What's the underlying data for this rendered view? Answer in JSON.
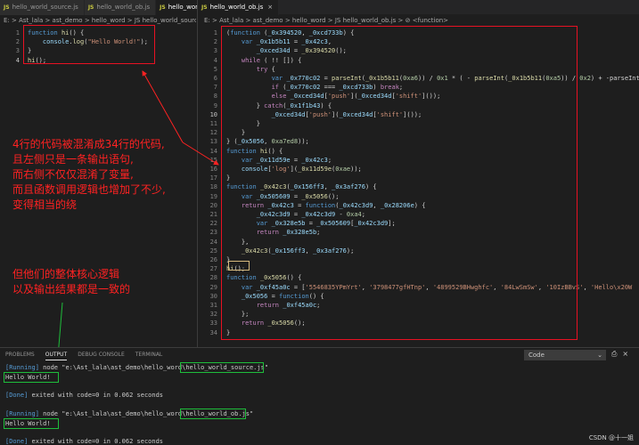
{
  "left_tabs": [
    {
      "label": "hello_world_source.js",
      "active": false
    },
    {
      "label": "hello_world_ob.js",
      "active": false
    },
    {
      "label": "hello_world_source.js",
      "active": true
    }
  ],
  "right_tabs": [
    {
      "label": "hello_world_ob.js",
      "active": true
    }
  ],
  "left_breadcrumb": "E: > Ast_lala > ast_demo > hello_word > JS hello_world_source.js > ...",
  "right_breadcrumb": "E: > Ast_lala > ast_demo > hello_word > JS hello_world_ob.js > ⊘ <function>",
  "left_code": [
    {
      "n": "1",
      "t": [
        [
          "kw",
          "function "
        ],
        [
          "fn",
          "hi"
        ],
        [
          "pn",
          "() {"
        ]
      ]
    },
    {
      "n": "2",
      "t": [
        [
          "pn",
          "    "
        ],
        [
          "vr",
          "console"
        ],
        [
          "pn",
          "."
        ],
        [
          "fn",
          "log"
        ],
        [
          "pn",
          "("
        ],
        [
          "str",
          "\"Hello World!\""
        ],
        [
          "pn",
          ");"
        ]
      ]
    },
    {
      "n": "3",
      "t": [
        [
          "pn",
          "}"
        ]
      ]
    },
    {
      "n": "4",
      "t": [
        [
          "fn",
          "hi"
        ],
        [
          "pn",
          "();"
        ]
      ]
    }
  ],
  "right_code": [
    {
      "n": "1",
      "t": [
        [
          "pn",
          "("
        ],
        [
          "kw",
          "function"
        ],
        [
          "pn",
          " ("
        ],
        [
          "vr",
          "_0x394520"
        ],
        [
          "pn",
          ", "
        ],
        [
          "vr",
          "_0xcd733b"
        ],
        [
          "pn",
          ") {"
        ]
      ]
    },
    {
      "n": "2",
      "t": [
        [
          "pn",
          "    "
        ],
        [
          "kw",
          "var "
        ],
        [
          "vr",
          "_0x1b5b11"
        ],
        [
          "pn",
          " = "
        ],
        [
          "vr",
          "_0x42c3"
        ],
        [
          "pn",
          ","
        ]
      ]
    },
    {
      "n": "3",
      "t": [
        [
          "pn",
          "        "
        ],
        [
          "vr",
          "_0xced34d"
        ],
        [
          "pn",
          " = "
        ],
        [
          "fn",
          "_0x394520"
        ],
        [
          "pn",
          "();"
        ]
      ]
    },
    {
      "n": "4",
      "t": [
        [
          "pn",
          "    "
        ],
        [
          "ctl",
          "while"
        ],
        [
          "pn",
          " ( !! []) {"
        ]
      ]
    },
    {
      "n": "5",
      "t": [
        [
          "pn",
          "        "
        ],
        [
          "ctl",
          "try"
        ],
        [
          "pn",
          " {"
        ]
      ]
    },
    {
      "n": "6",
      "t": [
        [
          "pn",
          "            "
        ],
        [
          "kw",
          "var "
        ],
        [
          "vr",
          "_0x770c02"
        ],
        [
          "pn",
          " = "
        ],
        [
          "fn",
          "parseInt"
        ],
        [
          "pn",
          "("
        ],
        [
          "fn",
          "_0x1b5b11"
        ],
        [
          "pn",
          "("
        ],
        [
          "num",
          "0xa6"
        ],
        [
          "pn",
          ")) / "
        ],
        [
          "num",
          "0x1"
        ],
        [
          "pn",
          " * ( - "
        ],
        [
          "fn",
          "parseInt"
        ],
        [
          "pn",
          "("
        ],
        [
          "fn",
          "_0x1b5b11"
        ],
        [
          "pn",
          "("
        ],
        [
          "num",
          "0xa5"
        ],
        [
          "pn",
          ")) / "
        ],
        [
          "num",
          "0x2"
        ],
        [
          "pn",
          ") + -parseInt"
        ]
      ]
    },
    {
      "n": "7",
      "t": [
        [
          "pn",
          "            "
        ],
        [
          "ctl",
          "if"
        ],
        [
          "pn",
          " ("
        ],
        [
          "vr",
          "_0x770c02"
        ],
        [
          "pn",
          " === "
        ],
        [
          "vr",
          "_0xcd733b"
        ],
        [
          "pn",
          ") "
        ],
        [
          "ctl",
          "break"
        ],
        [
          "pn",
          ";"
        ]
      ]
    },
    {
      "n": "8",
      "t": [
        [
          "pn",
          "            "
        ],
        [
          "ctl",
          "else "
        ],
        [
          "vr",
          "_0xced34d"
        ],
        [
          "pn",
          "["
        ],
        [
          "str",
          "'push'"
        ],
        [
          "pn",
          "]("
        ],
        [
          "vr",
          "_0xced34d"
        ],
        [
          "pn",
          "["
        ],
        [
          "str",
          "'shift'"
        ],
        [
          "pn",
          "]());"
        ]
      ]
    },
    {
      "n": "9",
      "t": [
        [
          "pn",
          "        } "
        ],
        [
          "ctl",
          "catch"
        ],
        [
          "pn",
          "("
        ],
        [
          "vr",
          "_0x1f1b43"
        ],
        [
          "pn",
          ") {"
        ]
      ]
    },
    {
      "n": "10",
      "t": [
        [
          "pn",
          "            "
        ],
        [
          "vr",
          "_0xced34d"
        ],
        [
          "pn",
          "["
        ],
        [
          "str",
          "'push'"
        ],
        [
          "pn",
          "]("
        ],
        [
          "vr",
          "_0xced34d"
        ],
        [
          "pn",
          "["
        ],
        [
          "str",
          "'shift'"
        ],
        [
          "pn",
          "]());"
        ]
      ]
    },
    {
      "n": "11",
      "t": [
        [
          "pn",
          "        }"
        ]
      ]
    },
    {
      "n": "12",
      "t": [
        [
          "pn",
          "    }"
        ]
      ]
    },
    {
      "n": "13",
      "t": [
        [
          "pn",
          "} ("
        ],
        [
          "vr",
          "_0x5056"
        ],
        [
          "pn",
          ", "
        ],
        [
          "num",
          "0xa7ed8"
        ],
        [
          "pn",
          "));"
        ]
      ]
    },
    {
      "n": "14",
      "t": [
        [
          "kw",
          "function "
        ],
        [
          "fn",
          "hi"
        ],
        [
          "pn",
          "() {"
        ]
      ]
    },
    {
      "n": "15",
      "t": [
        [
          "pn",
          "    "
        ],
        [
          "kw",
          "var "
        ],
        [
          "vr",
          "_0x11d59e"
        ],
        [
          "pn",
          " = "
        ],
        [
          "vr",
          "_0x42c3"
        ],
        [
          "pn",
          ";"
        ]
      ]
    },
    {
      "n": "16",
      "t": [
        [
          "pn",
          "    "
        ],
        [
          "vr",
          "console"
        ],
        [
          "pn",
          "["
        ],
        [
          "str",
          "'log'"
        ],
        [
          "pn",
          "]("
        ],
        [
          "fn",
          "_0x11d59e"
        ],
        [
          "pn",
          "("
        ],
        [
          "num",
          "0xae"
        ],
        [
          "pn",
          "));"
        ]
      ]
    },
    {
      "n": "17",
      "t": [
        [
          "pn",
          "}"
        ]
      ]
    },
    {
      "n": "18",
      "t": [
        [
          "kw",
          "function "
        ],
        [
          "fn",
          "_0x42c3"
        ],
        [
          "pn",
          "("
        ],
        [
          "vr",
          "_0x156ff3"
        ],
        [
          "pn",
          ", "
        ],
        [
          "vr",
          "_0x3af276"
        ],
        [
          "pn",
          ") {"
        ]
      ]
    },
    {
      "n": "19",
      "t": [
        [
          "pn",
          "    "
        ],
        [
          "kw",
          "var "
        ],
        [
          "vr",
          "_0x505609"
        ],
        [
          "pn",
          " = "
        ],
        [
          "fn",
          "_0x5056"
        ],
        [
          "pn",
          "();"
        ]
      ]
    },
    {
      "n": "20",
      "t": [
        [
          "pn",
          "    "
        ],
        [
          "ctl",
          "return "
        ],
        [
          "vr",
          "_0x42c3"
        ],
        [
          "pn",
          " = "
        ],
        [
          "kw",
          "function"
        ],
        [
          "pn",
          "("
        ],
        [
          "vr",
          "_0x42c3d9"
        ],
        [
          "pn",
          ", "
        ],
        [
          "vr",
          "_0x28206e"
        ],
        [
          "pn",
          ") {"
        ]
      ]
    },
    {
      "n": "21",
      "t": [
        [
          "pn",
          "        "
        ],
        [
          "vr",
          "_0x42c3d9"
        ],
        [
          "pn",
          " = "
        ],
        [
          "vr",
          "_0x42c3d9"
        ],
        [
          "pn",
          " - "
        ],
        [
          "num",
          "0xa4"
        ],
        [
          "pn",
          ";"
        ]
      ]
    },
    {
      "n": "22",
      "t": [
        [
          "pn",
          "        "
        ],
        [
          "kw",
          "var "
        ],
        [
          "vr",
          "_0x328e5b"
        ],
        [
          "pn",
          " = "
        ],
        [
          "vr",
          "_0x505609"
        ],
        [
          "pn",
          "["
        ],
        [
          "vr",
          "_0x42c3d9"
        ],
        [
          "pn",
          "];"
        ]
      ]
    },
    {
      "n": "23",
      "t": [
        [
          "pn",
          "        "
        ],
        [
          "ctl",
          "return "
        ],
        [
          "vr",
          "_0x328e5b"
        ],
        [
          "pn",
          ";"
        ]
      ]
    },
    {
      "n": "24",
      "t": [
        [
          "pn",
          "    },"
        ]
      ]
    },
    {
      "n": "25",
      "t": [
        [
          "pn",
          "    "
        ],
        [
          "fn",
          "_0x42c3"
        ],
        [
          "pn",
          "("
        ],
        [
          "vr",
          "_0x156ff3"
        ],
        [
          "pn",
          ", "
        ],
        [
          "vr",
          "_0x3af276"
        ],
        [
          "pn",
          ");"
        ]
      ]
    },
    {
      "n": "26",
      "t": [
        [
          "pn",
          "}"
        ]
      ]
    },
    {
      "n": "27",
      "t": [
        [
          "fn",
          "hi"
        ],
        [
          "pn",
          "();"
        ]
      ]
    },
    {
      "n": "28",
      "t": [
        [
          "kw",
          "function "
        ],
        [
          "fn",
          "_0x5056"
        ],
        [
          "pn",
          "() {"
        ]
      ]
    },
    {
      "n": "29",
      "t": [
        [
          "pn",
          "    "
        ],
        [
          "kw",
          "var "
        ],
        [
          "vr",
          "_0xf45a0c"
        ],
        [
          "pn",
          " = ["
        ],
        [
          "str",
          "'5546835YPmYrt'"
        ],
        [
          "pn",
          ", "
        ],
        [
          "str",
          "'3798477gfHTnp'"
        ],
        [
          "pn",
          ", "
        ],
        [
          "str",
          "'4899529BHwghfc'"
        ],
        [
          "pn",
          ", "
        ],
        [
          "str",
          "'84LwSmSw'"
        ],
        [
          "pn",
          ", "
        ],
        [
          "str",
          "'10IzBBvS'"
        ],
        [
          "pn",
          ", "
        ],
        [
          "str",
          "'Hello\\x20W"
        ]
      ]
    },
    {
      "n": "30",
      "t": [
        [
          "pn",
          "    "
        ],
        [
          "vr",
          "_0x5056"
        ],
        [
          "pn",
          " = "
        ],
        [
          "kw",
          "function"
        ],
        [
          "pn",
          "() {"
        ]
      ]
    },
    {
      "n": "31",
      "t": [
        [
          "pn",
          "        "
        ],
        [
          "ctl",
          "return "
        ],
        [
          "vr",
          "_0xf45a0c"
        ],
        [
          "pn",
          ";"
        ]
      ]
    },
    {
      "n": "32",
      "t": [
        [
          "pn",
          "    };"
        ]
      ]
    },
    {
      "n": "33",
      "t": [
        [
          "pn",
          "    "
        ],
        [
          "ctl",
          "return "
        ],
        [
          "fn",
          "_0x5056"
        ],
        [
          "pn",
          "();"
        ]
      ]
    },
    {
      "n": "34",
      "t": [
        [
          "pn",
          "}"
        ]
      ]
    }
  ],
  "annotation_1": [
    "4行的代码被混淆成34行的代码,",
    "且左侧只是一条输出语句,",
    "而右侧不仅仅混淆了变量,",
    "而且函数调用逻辑也增加了不少,",
    "变得相当的绕"
  ],
  "annotation_2": [
    "但他们的整体核心逻辑",
    "以及输出结果都是一致的"
  ],
  "panel_tabs": [
    "PROBLEMS",
    "OUTPUT",
    "DEBUG CONSOLE",
    "TERMINAL"
  ],
  "panel_active_tab": "OUTPUT",
  "output_channel": "Code",
  "output": {
    "run1_prefix": "[Running] node \"e:\\Ast_lala\\ast_demo\\hello_word\\",
    "run1_file": "hello_world_source.js",
    "run1_suffix": "\"",
    "result1": "Hello World!",
    "done1": "[Done] exited with code=0 in 0.062 seconds",
    "run2_prefix": "[Running] node \"e:\\Ast_lala\\ast_demo\\hello_word\\",
    "run2_file": "hello_world_ob.js",
    "run2_suffix": "\"",
    "result2": "Hello World!",
    "done2": "[Done] exited with code=0 in 0.062 seconds"
  },
  "watermark": "CSDN @十一姐"
}
